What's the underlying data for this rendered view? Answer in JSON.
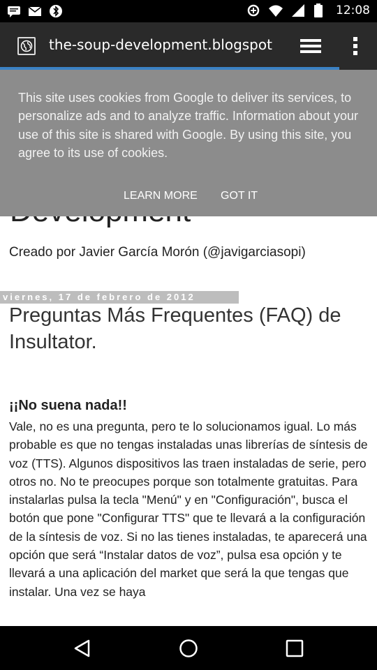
{
  "status_bar": {
    "time": "12:08",
    "left_icons": [
      "message-icon",
      "mail-icon",
      "bluetooth-icon"
    ],
    "right_icons": [
      "data-saver-icon",
      "wifi-icon",
      "signal-icon",
      "battery-icon"
    ]
  },
  "toolbar": {
    "url": "the-soup-development.blogspot",
    "site_icon": "globe-icon",
    "tabs_icon": "tabs-stack-icon",
    "menu_icon": "overflow-menu-icon"
  },
  "progress": {
    "fraction": 0.9,
    "color": "#3b82c4"
  },
  "cookie_banner": {
    "message": "This site uses cookies from Google to deliver its services, to personalize ads and to analyze traffic. Information about your use of this site is shared with Google. By using this site, you agree to its use of cookies.",
    "learn_more_label": "LEARN MORE",
    "got_it_label": "GOT IT"
  },
  "blog": {
    "title": "Development",
    "byline": "Creado por Javier García Morón (@javigarciasopi)",
    "date": "viernes, 17 de febrero de 2012",
    "post_title": "Preguntas Más Frequentes (FAQ) de Insultator.",
    "post_subhead": "¡¡No suena nada!!",
    "post_body": "Vale, no es una pregunta, pero te lo solucionamos igual. Lo más probable es que no tengas instaladas unas librerías de síntesis de voz (TTS). Algunos dispositivos las traen instaladas de serie, pero otros no. No te preocupes porque son totalmente gratuitas. Para instalarlas pulsa la tecla \"Menú\" y en \"Configuración\", busca el botón que pone \"Configurar TTS\" que te llevará a la configuración de la síntesis de voz. Si no las tienes instaladas, te aparecerá una opción que será “Instalar datos de voz”, pulsa esa opción y te llevará a una aplicación del market que será la que tengas que instalar. Una vez se haya"
  },
  "nav_bar": {
    "back_icon": "back-icon",
    "home_icon": "home-icon",
    "recents_icon": "recents-icon"
  }
}
